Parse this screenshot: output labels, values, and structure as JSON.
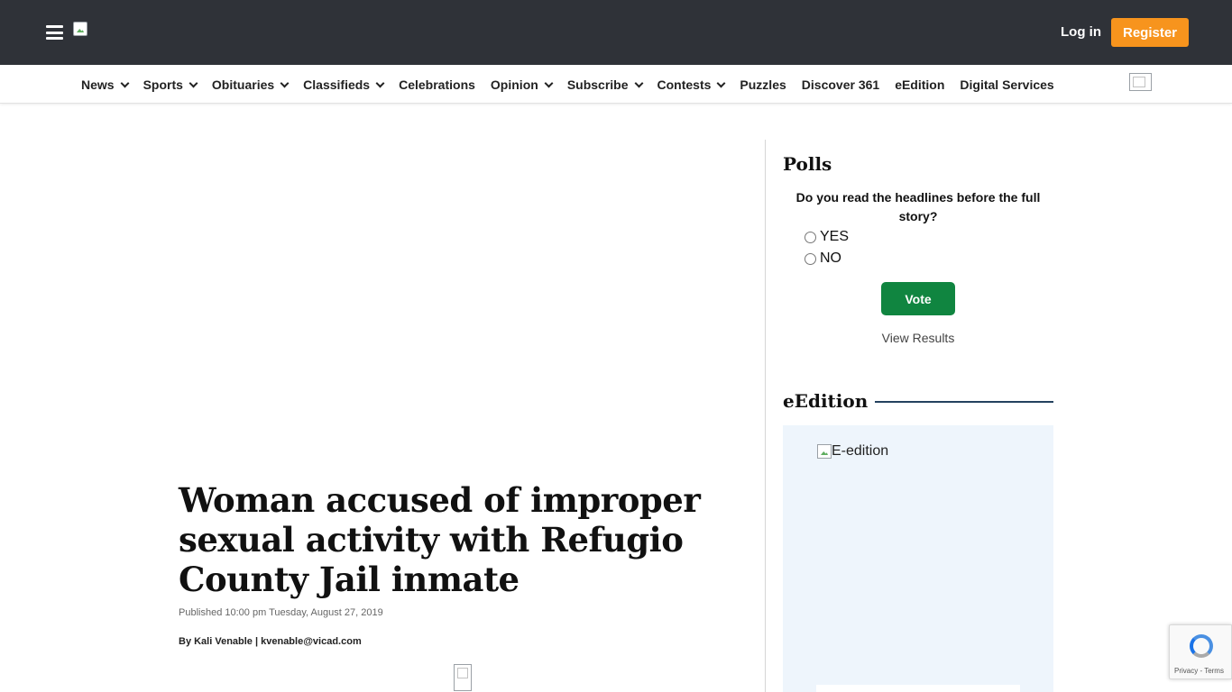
{
  "header": {
    "login_label": "Log in",
    "register_label": "Register",
    "register_color": "#f7941d",
    "background_color": "#2f3238"
  },
  "nav": {
    "items": [
      {
        "label": "News",
        "dropdown": true
      },
      {
        "label": "Sports",
        "dropdown": true
      },
      {
        "label": "Obituaries",
        "dropdown": true
      },
      {
        "label": "Classifieds",
        "dropdown": true
      },
      {
        "label": "Celebrations",
        "dropdown": false
      },
      {
        "label": "Opinion",
        "dropdown": true
      },
      {
        "label": "Subscribe",
        "dropdown": true
      },
      {
        "label": "Contests",
        "dropdown": true
      },
      {
        "label": "Puzzles",
        "dropdown": false
      },
      {
        "label": "Discover 361",
        "dropdown": false
      },
      {
        "label": "eEdition",
        "dropdown": false
      },
      {
        "label": "Digital Services",
        "dropdown": false
      }
    ]
  },
  "article": {
    "headline": "Woman accused of improper sexual activity with Refugio County Jail inmate",
    "published": "Published 10:00 pm Tuesday, August 27, 2019",
    "byline": "By Kali Venable | kvenable@vicad.com"
  },
  "sidebar": {
    "polls": {
      "title": "Polls",
      "question": "Do you read the headlines before the full story?",
      "options": [
        "YES",
        "NO"
      ],
      "vote_label": "Vote",
      "vote_color": "#108540",
      "view_results_label": "View Results"
    },
    "eedition": {
      "title": "eEdition",
      "image_alt": "E-edition"
    }
  },
  "recaptcha": {
    "links": "Privacy - Terms"
  }
}
